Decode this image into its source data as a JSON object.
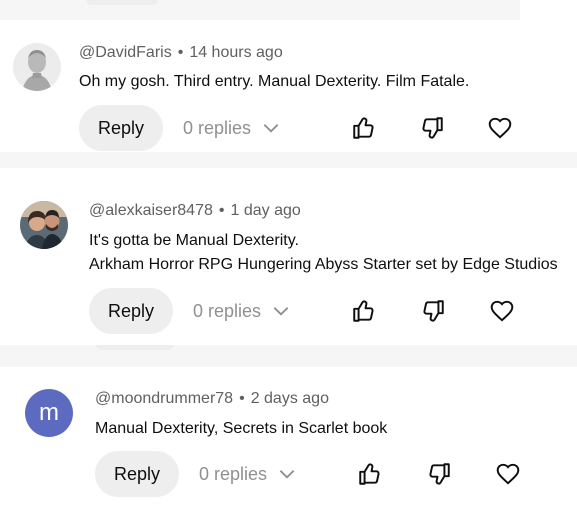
{
  "comments": [
    {
      "author": "@DavidFaris",
      "time": "14 hours ago",
      "lines": [
        "Oh my gosh. Third entry. Manual Dexterity. Film Fatale."
      ],
      "avatar_icon": "statue-avatar-icon"
    },
    {
      "author": "@alexkaiser8478",
      "time": "1 day ago",
      "lines": [
        "It's gotta be Manual Dexterity.",
        "Arkham Horror RPG Hungering Abyss Starter set by Edge Studios"
      ],
      "avatar_icon": "couple-photo-avatar-icon"
    },
    {
      "author": "@moondrummer78",
      "time": "2 days ago",
      "lines": [
        "Manual Dexterity, Secrets in Scarlet book"
      ],
      "avatar_letter": "m",
      "avatar_color": "#5c6bc0"
    }
  ],
  "actions": {
    "reply_label": "Reply",
    "replies_label": "0 replies",
    "icons": [
      "thumbs-up-icon",
      "thumbs-down-icon",
      "heart-icon",
      "chevron-down-icon"
    ]
  },
  "dot": "•"
}
